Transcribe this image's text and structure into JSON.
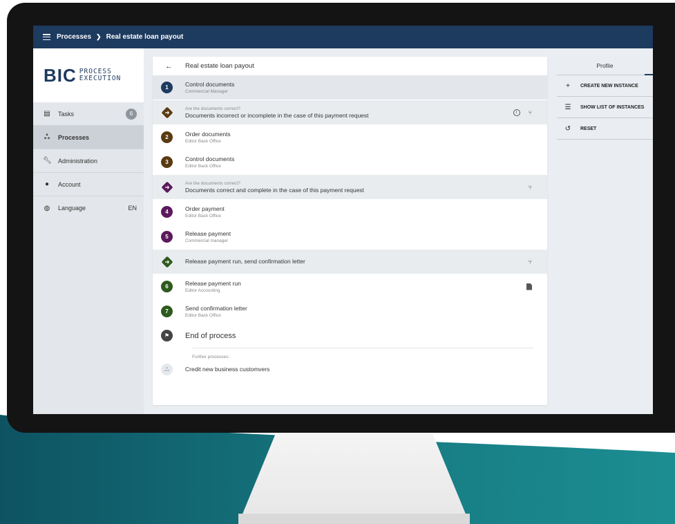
{
  "topbar": {
    "crumb1": "Processes",
    "crumb2": "Real estate loan payout"
  },
  "logo": {
    "brand": "BIC",
    "sub1": "PROCESS",
    "sub2": "EXECUTION"
  },
  "sidebar": {
    "items": [
      {
        "label": "Tasks",
        "icon": "clipboard-icon",
        "badge": "6"
      },
      {
        "label": "Processes",
        "icon": "sitemap-icon"
      },
      {
        "label": "Administration",
        "icon": "wrench-icon"
      },
      {
        "label": "Account",
        "icon": "account-icon"
      },
      {
        "label": "Language",
        "icon": "globe-icon",
        "value": "EN"
      }
    ]
  },
  "panel": {
    "title": "Real estate loan payout",
    "steps": [
      {
        "num": "1",
        "title": "Control documents",
        "role": "Commercial Manager",
        "color": "#1d3a5f"
      },
      {
        "question": "Are the documents correct?",
        "title": "Documents incorrect or incomplete in the case of this payment request",
        "color": "#5a3a12"
      },
      {
        "num": "2",
        "title": "Order documents",
        "role": "Editor Back Office",
        "color": "#5a3a12"
      },
      {
        "num": "3",
        "title": "Control documents",
        "role": "Editor Back Office",
        "color": "#5a3a12"
      },
      {
        "question": "Are the documents correct?",
        "title": "Documents correct and complete in the case of this payment request",
        "color": "#5b1a5b"
      },
      {
        "num": "4",
        "title": "Order payment",
        "role": "Editor Back Office",
        "color": "#5b1a5b"
      },
      {
        "num": "5",
        "title": "Release payment",
        "role": "Commercial manager",
        "color": "#5b1a5b"
      },
      {
        "title": "Release payment run, send confirmation letter",
        "color": "#2e5a1e"
      },
      {
        "num": "6",
        "title": "Release payment run",
        "role": "Editor Accounting",
        "color": "#2e5a1e"
      },
      {
        "num": "7",
        "title": "Send confirmation letter",
        "role": "Editor Back Office",
        "color": "#2e5a1e"
      }
    ],
    "end_label": "End of process",
    "further_label": "Further processes:",
    "further_item": "Credit new business customvers"
  },
  "right": {
    "tab": "Profile",
    "actions": [
      {
        "icon": "plus-icon",
        "label": "CREATE NEW INSTANCE"
      },
      {
        "icon": "list-icon",
        "label": "SHOW LIST OF INSTANCES"
      },
      {
        "icon": "history-icon",
        "label": "RESET"
      }
    ]
  },
  "colors": {
    "topbar": "#1d3a5f",
    "wave_dark": "#0f5a66",
    "wave_teal": "#1a8a8f"
  }
}
